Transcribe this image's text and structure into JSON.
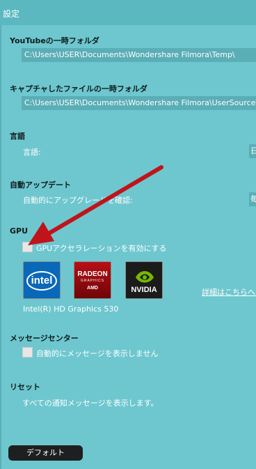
{
  "window": {
    "title": "設定"
  },
  "youtube_temp": {
    "heading": "YouTubeの一時フォルダ",
    "path": "C:\\Users\\USER\\Documents\\Wondershare Filmora\\Temp\\"
  },
  "capture_temp": {
    "heading": "キャプチャしたファイルの一時フォルダ",
    "path": "C:\\Users\\USER\\Documents\\Wondershare Filmora\\UserSource\\"
  },
  "language": {
    "heading": "言語",
    "label": "言語:",
    "selected": "日"
  },
  "auto_update": {
    "heading": "自動アップデート",
    "label": "自動的にアップグレードを確認:",
    "selected": "毎"
  },
  "gpu": {
    "heading": "GPU",
    "checkbox_label": "GPUアクセラレーションを有効にする",
    "checked": false,
    "logos": {
      "intel": "intel",
      "amd_top": "RADEON",
      "amd_mid": "GRAPHICS",
      "amd_bottom": "AMD",
      "nvidia": "NVIDIA"
    },
    "device": "Intel(R) HD Graphics 530",
    "more_link": "詳細はこちらへ..."
  },
  "message_center": {
    "heading": "メッセージセンター",
    "checkbox_label": "自動的にメッセージを表示しません",
    "checked": false
  },
  "reset": {
    "heading": "リセット",
    "label": "すべての通知メッセージを表示します。"
  },
  "buttons": {
    "default_label": "デフォルト"
  },
  "colors": {
    "background": "#6ec7cf",
    "field": "#5aaeb6",
    "annotation_arrow": "#c0141a",
    "button": "#1d1f20"
  }
}
